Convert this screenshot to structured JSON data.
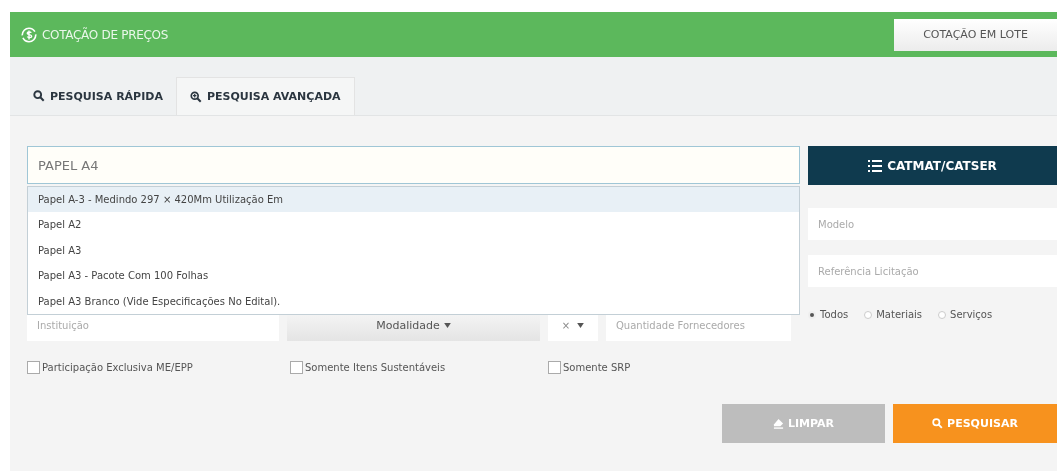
{
  "header": {
    "title": "COTAÇÃO DE PREÇOS",
    "batch_button": "COTAÇÃO EM LOTE"
  },
  "tabs": [
    {
      "label": "PESQUISA RÁPIDA",
      "kind": "quick",
      "selected": false
    },
    {
      "label": "PESQUISA AVANÇADA",
      "kind": "advanced",
      "selected": true
    }
  ],
  "search": {
    "value": "PAPEL A4"
  },
  "suggestions": [
    {
      "label": "Papel A-3 - Medindo 297 × 420Mm Utilização Em",
      "selected": true
    },
    {
      "label": "Papel A2",
      "selected": false
    },
    {
      "label": "Papel A3",
      "selected": false
    },
    {
      "label": "Papel A3 - Pacote Com 100 Folhas",
      "selected": false
    },
    {
      "label": "Papel A3 Branco (Vide Especificações No Edital).",
      "selected": false
    }
  ],
  "catmat_button": "CATMAT/CATSER",
  "model_field": {
    "placeholder": "Modelo"
  },
  "reference_field": {
    "placeholder": "Referência Licitação"
  },
  "institution_field": {
    "placeholder": "Instituição"
  },
  "modality_button": "Modalidade",
  "operator_select": {
    "value": "×"
  },
  "suppliers_field": {
    "placeholder": "Quantidade Fornecedores"
  },
  "type_radios": [
    {
      "label": "Todos",
      "selected": true
    },
    {
      "label": "Materiais",
      "selected": false
    },
    {
      "label": "Serviços",
      "selected": false
    }
  ],
  "checkboxes": [
    {
      "label": "Participação Exclusiva ME/EPP",
      "checked": false
    },
    {
      "label": "Somente Itens Sustentáveis",
      "checked": false
    },
    {
      "label": "Somente SRP",
      "checked": false
    }
  ],
  "buttons": [
    {
      "label": "LIMPAR",
      "kind": "clear"
    },
    {
      "label": "PESQUISAR",
      "kind": "search"
    }
  ]
}
